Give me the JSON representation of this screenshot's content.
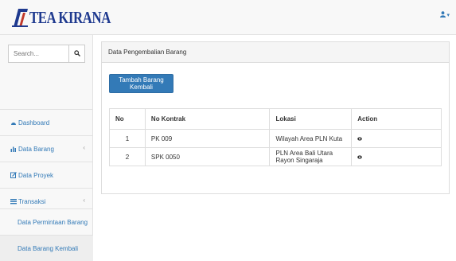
{
  "brand": {
    "name": "TEA KIRANA",
    "color": "#1f3a8f"
  },
  "user_menu": {
    "icon": "user-icon",
    "caret": "▾"
  },
  "sidebar": {
    "search_placeholder": "Search...",
    "items": [
      {
        "label": "Dashboard",
        "icon": "dashboard-icon"
      },
      {
        "label": "Data Barang",
        "icon": "bar-chart-icon",
        "has_children": true
      },
      {
        "label": "Data Proyek",
        "icon": "edit-icon"
      },
      {
        "label": "Transaksi",
        "icon": "list-icon",
        "has_children": true
      }
    ],
    "subitems": [
      {
        "label": "Data Permintaan Barang"
      },
      {
        "label": "Data Barang Kembali",
        "active": true
      }
    ]
  },
  "panel": {
    "heading": "Data Pengembalian Barang",
    "add_button": "Tambah Barang Kembali"
  },
  "table": {
    "headers": [
      "No",
      "No Kontrak",
      "Lokasi",
      "Action"
    ],
    "rows": [
      {
        "no": "1",
        "kontrak": "PK 009",
        "lokasi": "Wilayah Area PLN Kuta"
      },
      {
        "no": "2",
        "kontrak": "SPK 0050",
        "lokasi": "PLN Area Bali Utara Rayon Singaraja"
      }
    ]
  },
  "colors": {
    "accent": "#337ab7",
    "topbar": "#f8f8f8",
    "sidebar": "#f8f8f8"
  }
}
